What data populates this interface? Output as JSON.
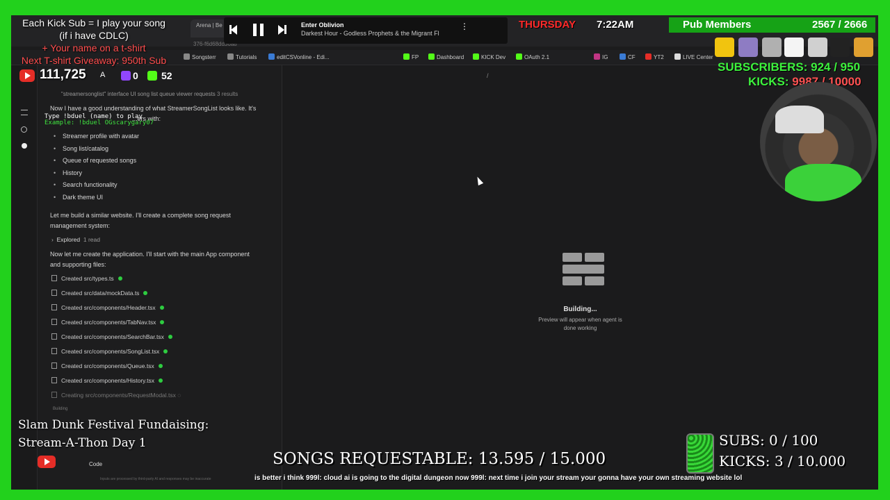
{
  "browser": {
    "tabs": [
      "Arena | Be"
    ],
    "url_fragment": "376-f6d68dd36a8",
    "bookmarks": [
      "Songsterr",
      "Tutorials",
      "editCSVonline - Edi...",
      "FP",
      "Dashboard",
      "KICK Dev",
      "OAuth 2.1",
      "IG",
      "CF",
      "YT2",
      "LIVE Center"
    ]
  },
  "chat": {
    "header_partial": "\"streamersonglist\" interface UI song list queue viewer requests",
    "header_results": "3 results",
    "intro": "Now I have a good understanding of what StreamerSongList looks like. It's",
    "intro2": "...ers with:",
    "bullets": [
      "Streamer profile with avatar",
      "Song list/catalog",
      "Queue of requested songs",
      "History",
      "Search functionality",
      "Dark theme UI"
    ],
    "para1_l1": "Let me build a similar website. I'll create a complete song request",
    "para1_l2": "management system:",
    "explored": "Explored",
    "explored_count": "1 read",
    "para2_l1": "Now let me create the application. I'll start with the main App component",
    "para2_l2": "and supporting files:",
    "files": [
      "Created src/types.ts",
      "Created src/data/mockData.ts",
      "Created src/components/Header.tsx",
      "Created src/components/TabNav.tsx",
      "Created src/components/SearchBar.tsx",
      "Created src/components/SongList.tsx",
      "Created src/components/Queue.tsx",
      "Created src/components/History.tsx"
    ],
    "creating": "Creating src/components/RequestModal.tsx",
    "building_small": "Building",
    "code_label": "Code",
    "footer_note": "Inputs are processed by third-party AI and responses may be inaccurate"
  },
  "preview": {
    "path": "/",
    "building": "Building...",
    "sub1": "Preview will appear when agent is",
    "sub2": "done working"
  },
  "overlay": {
    "kick_sub_l1": "Each Kick Sub = I play your song",
    "kick_sub_l2": "(if i have CDLC)",
    "kick_sub_l3": "+ Your name on a t-shirt",
    "kick_sub_l4": "Next T-shirt Giveaway: 950th Sub",
    "yt_count": "111,725",
    "yt_a": "A",
    "twitch_count": "0",
    "kick_count": "52",
    "duel_l1": "Type !bduel (name) to play",
    "duel_l2": "Example: !bduel OGscarygary07",
    "media_title": "Enter Oblivion",
    "media_artist": "Darkest Hour - Godless Prophets & the Migrant Fl",
    "day": "THURSDAY",
    "time": "7:22AM",
    "pub_label": "Pub Members",
    "pub_count": "2567 / 2666",
    "subs_label": "SUBSCRIBERS:",
    "subs_value": "924 / 950",
    "kicks_label": "KICKS:",
    "kicks_value": "9987 / 10000",
    "fund_l1": "Slam Dunk Festival Fundaising:",
    "fund_l2": "Stream-A-Thon Day 1",
    "songs_req": "SONGS REQUESTABLE: 13.595 / 15.000",
    "subs_goal": "SUBS:  0 / 100",
    "kicks_goal": "KICKS: 3 / 10.000",
    "ticker": "is better i think  999l: cloud ai is going to the digital dungeon now  999l: next time i join your stream your gonna have your own streaming website lol"
  },
  "colors": {
    "green": "#22d11c",
    "red_text": "#ff3b30",
    "gold": "#ffcc33"
  }
}
